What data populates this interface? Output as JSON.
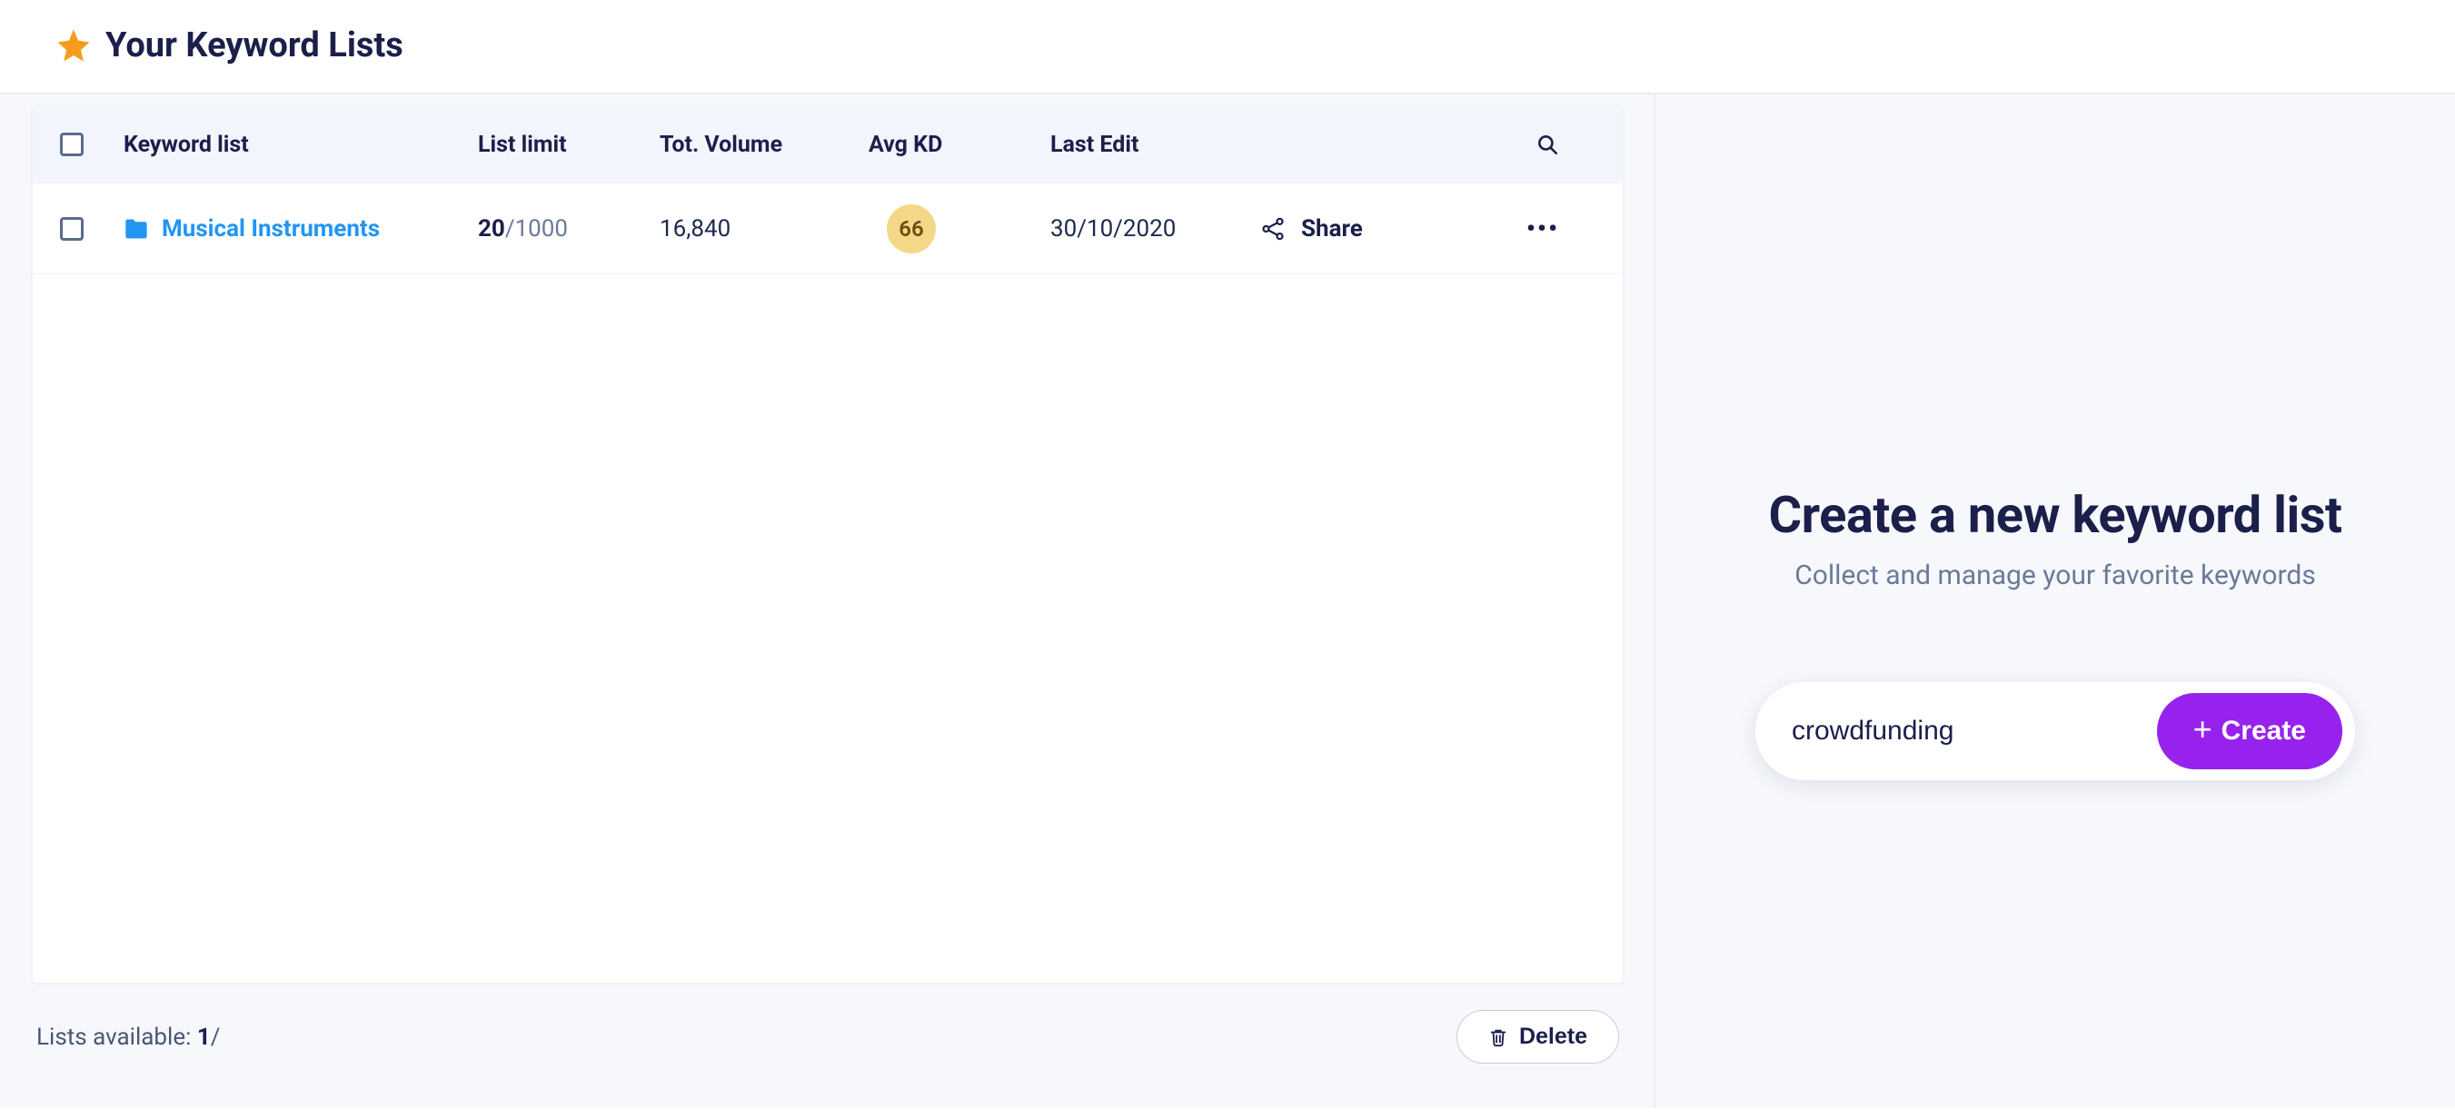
{
  "header": {
    "title": "Your Keyword Lists"
  },
  "table": {
    "columns": {
      "keyword_list": "Keyword list",
      "list_limit": "List limit",
      "tot_volume": "Tot. Volume",
      "avg_kd": "Avg KD",
      "last_edit": "Last Edit"
    },
    "rows": [
      {
        "name": "Musical Instruments",
        "limit_current": "20",
        "limit_max": "/1000",
        "tot_volume": "16,840",
        "avg_kd": "66",
        "last_edit": "30/10/2020",
        "share_label": "Share"
      }
    ]
  },
  "footer": {
    "lists_available_prefix": "Lists available: ",
    "lists_available_count": "1",
    "lists_available_suffix": "/",
    "delete_label": "Delete"
  },
  "right": {
    "title": "Create a new keyword list",
    "subtitle": "Collect and manage your favorite keywords",
    "input_value": "crowdfunding",
    "create_label": "Create"
  },
  "colors": {
    "accent_purple": "#9822ed",
    "star_orange": "#f59d1b",
    "link_blue": "#2196f3",
    "kd_badge_bg": "#f5d788"
  }
}
